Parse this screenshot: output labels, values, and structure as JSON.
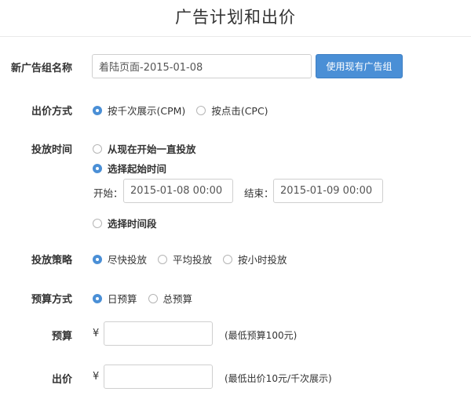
{
  "page": {
    "title": "广告计划和出价"
  },
  "ad_group_name": {
    "label": "新广告组名称",
    "value": "着陆页面-2015-01-08",
    "button_label": "使用现有广告组"
  },
  "bid_method": {
    "label": "出价方式",
    "options": [
      {
        "label": "按千次展示(CPM)",
        "selected": true
      },
      {
        "label": "按点击(CPC)",
        "selected": false
      }
    ]
  },
  "schedule": {
    "label": "投放时间",
    "options": [
      {
        "label": "从现在开始一直投放",
        "selected": false
      },
      {
        "label": "选择起始时间",
        "selected": true
      },
      {
        "label": "选择时间段",
        "selected": false
      }
    ],
    "start_label": "开始：",
    "start_value": "2015-01-08 00:00",
    "end_label": "结束：",
    "end_value": "2015-01-09 00:00"
  },
  "strategy": {
    "label": "投放策略",
    "options": [
      {
        "label": "尽快投放",
        "selected": true
      },
      {
        "label": "平均投放",
        "selected": false
      },
      {
        "label": "按小时投放",
        "selected": false
      }
    ]
  },
  "budget_type": {
    "label": "预算方式",
    "options": [
      {
        "label": "日预算",
        "selected": true
      },
      {
        "label": "总预算",
        "selected": false
      }
    ]
  },
  "budget": {
    "label": "预算",
    "currency": "¥",
    "value": "",
    "hint": "(最低预算100元)"
  },
  "bid": {
    "label": "出价",
    "currency": "¥",
    "value": "",
    "hint": "(最低出价10元/千次展示)"
  },
  "colors": {
    "accent": "#4a8fd6",
    "text": "#333333",
    "border": "#cfcfcf"
  }
}
